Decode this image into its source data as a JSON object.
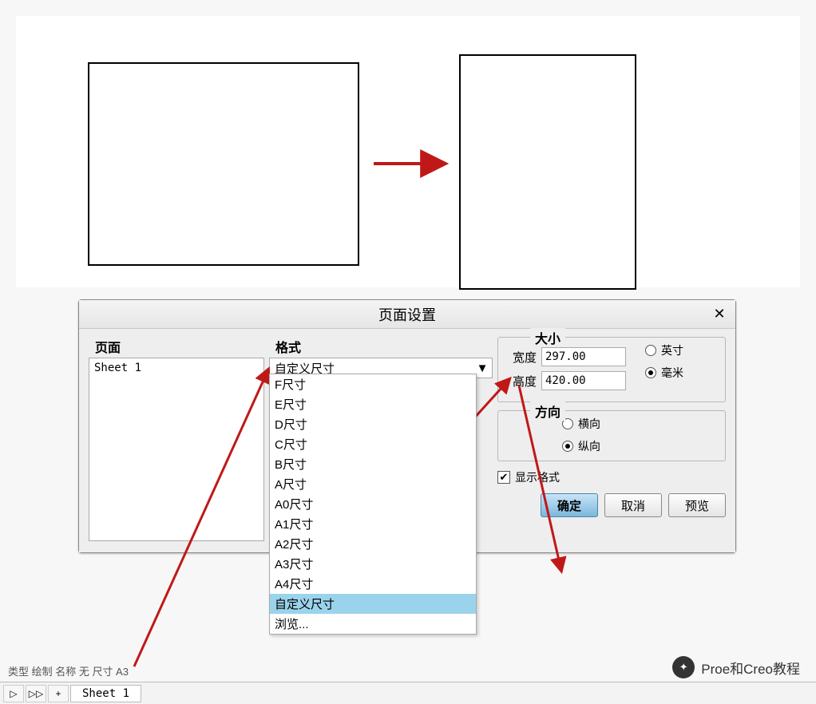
{
  "top_illustration": {
    "landscape_desc": "landscape-page",
    "portrait_desc": "portrait-page"
  },
  "dialog": {
    "title": "页面设置",
    "columns": {
      "page_label": "页面",
      "format_label": "格式"
    },
    "page_list": {
      "items": [
        "Sheet 1"
      ]
    },
    "format_combo": {
      "selected": "自定义尺寸",
      "options": [
        "F尺寸",
        "E尺寸",
        "D尺寸",
        "C尺寸",
        "B尺寸",
        "A尺寸",
        "A0尺寸",
        "A1尺寸",
        "A2尺寸",
        "A3尺寸",
        "A4尺寸",
        "自定义尺寸",
        "浏览..."
      ],
      "highlight_index": 11
    },
    "size_group": {
      "title": "大小",
      "width_label": "宽度",
      "width_value": "297.00",
      "height_label": "高度",
      "height_value": "420.00",
      "unit_inch": "英寸",
      "unit_mm": "毫米",
      "unit_selected": "mm"
    },
    "orient_group": {
      "title": "方向",
      "landscape": "横向",
      "portrait": "纵向",
      "selected": "portrait"
    },
    "show_format": {
      "label": "显示格式",
      "checked": true
    },
    "buttons": {
      "ok": "确定",
      "cancel": "取消",
      "preview": "预览"
    }
  },
  "footer": {
    "text": "类型 绘制  名称 无  尺寸 A3"
  },
  "tabbar": {
    "play": "▷",
    "ff": "▷▷",
    "add": "+",
    "tab_label": "Sheet 1"
  },
  "watermark": "Proe和Creo教程"
}
